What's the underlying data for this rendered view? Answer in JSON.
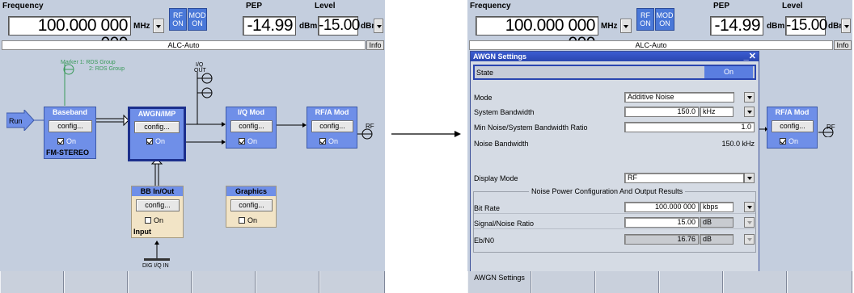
{
  "left_screen": {
    "header": {
      "frequency_label": "Frequency",
      "frequency_value": "100.000 000 000",
      "frequency_unit": "MHz",
      "rf_toggle": [
        "RF",
        "ON"
      ],
      "mod_toggle": [
        "MOD",
        "ON"
      ],
      "pep_label": "PEP",
      "pep_value": "-14.99",
      "pep_unit": "dBm",
      "level_label": "Level",
      "level_value": "-15.00",
      "level_unit": "dBm"
    },
    "status_text": "ALC-Auto",
    "info_button": "Info",
    "diagram": {
      "marker_line1": "Marker  1: RDS Group",
      "marker_line2": "2: RDS Group",
      "iq_out_line1": "I/Q",
      "iq_out_line2": "OUT",
      "run_label": "Run",
      "rf_label": "RF",
      "dig_iq_in": "DIG I/Q IN",
      "blocks": {
        "baseband": {
          "title": "Baseband",
          "config": "config...",
          "state": "On",
          "checked": true,
          "footer": "FM-STEREO"
        },
        "awgn": {
          "title": "AWGN/IMP",
          "config": "config...",
          "state": "On",
          "checked": true
        },
        "iqmod": {
          "title": "I/Q Mod",
          "config": "config...",
          "state": "On",
          "checked": true
        },
        "rfa": {
          "title": "RF/A Mod",
          "config": "config...",
          "state": "On",
          "checked": true
        },
        "bbinout": {
          "title": "BB In/Out",
          "config": "config...",
          "state": "On",
          "checked": false,
          "footer": "Input"
        },
        "graphics": {
          "title": "Graphics",
          "config": "config...",
          "state": "On",
          "checked": false
        }
      }
    },
    "softkeys": [
      "",
      "",
      "",
      "",
      "",
      ""
    ]
  },
  "right_screen": {
    "header": {
      "frequency_label": "Frequency",
      "frequency_value": "100.000 000 000",
      "frequency_unit": "MHz",
      "rf_toggle": [
        "RF",
        "ON"
      ],
      "mod_toggle": [
        "MOD",
        "ON"
      ],
      "pep_label": "PEP",
      "pep_value": "-14.99",
      "pep_unit": "dBm",
      "level_label": "Level",
      "level_value": "-15.00",
      "level_unit": "dBm"
    },
    "status_text": "ALC-Auto",
    "info_button": "Info",
    "dialog": {
      "title": "AWGN Settings",
      "state_label": "State",
      "state_value": "On",
      "mode_label": "Mode",
      "mode_value": "Additive Noise",
      "system_bw_label": "System Bandwidth",
      "system_bw_value": "150.0",
      "system_bw_unit": "kHz",
      "min_noise_label": "Min Noise/System Bandwidth Ratio",
      "min_noise_value": "1.0",
      "noise_bw_label": "Noise Bandwidth",
      "noise_bw_value": "150.0 kHz",
      "display_mode_label": "Display Mode",
      "display_mode_value": "RF",
      "group_title": "Noise Power Configuration And Output Results",
      "bit_rate_label": "Bit Rate",
      "bit_rate_value": "100.000 000",
      "bit_rate_unit": "kbps",
      "snr_label": "Signal/Noise Ratio",
      "snr_value": "15.00",
      "snr_unit": "dB",
      "ebn0_label": "Eb/N0",
      "ebn0_value": "16.76",
      "ebn0_unit": "dB"
    },
    "side_block": {
      "title": "RF/A Mod",
      "config": "config...",
      "state": "On",
      "checked": true
    },
    "rf_label": "RF",
    "softkeys": [
      "AWGN Settings",
      "",
      "",
      "",
      "",
      ""
    ]
  }
}
